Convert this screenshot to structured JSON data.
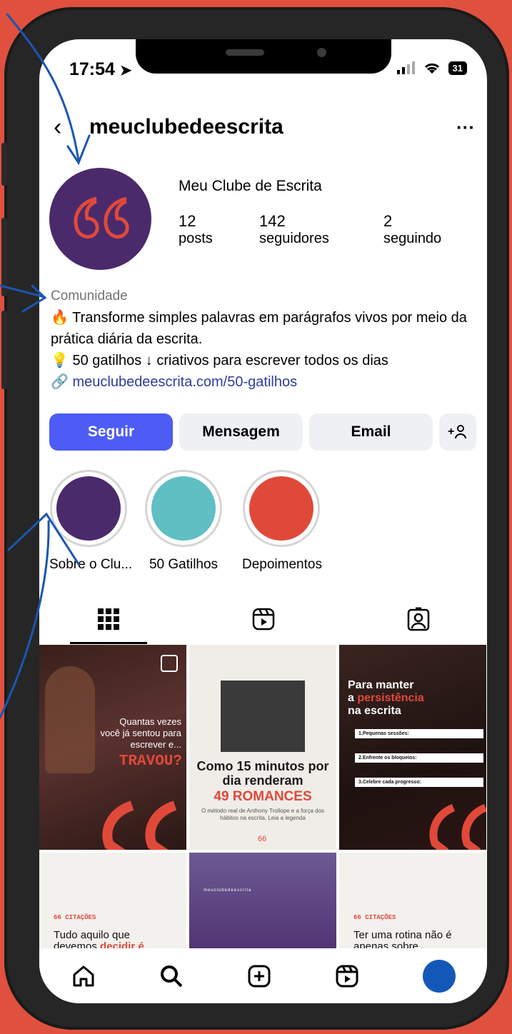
{
  "status_bar": {
    "time": "17:54",
    "battery": "31"
  },
  "header": {
    "username": "meuclubedeescrita"
  },
  "profile": {
    "name": "Meu Clube de Escrita",
    "stats": [
      {
        "value": "12",
        "label": "posts"
      },
      {
        "value": "142",
        "label": "seguidores"
      },
      {
        "value": "2",
        "label": "seguindo"
      }
    ],
    "category": "Comunidade",
    "bio_line1": "Transforme simples palavras em parágrafos vivos por meio da prática diária da escrita.",
    "bio_line2": "50 gatilhos ↓ criativos para escrever todos os dias",
    "link": "meuclubedeescrita.com/50-gatilhos"
  },
  "buttons": {
    "follow": "Seguir",
    "message": "Mensagem",
    "email": "Email",
    "add_person": "+"
  },
  "highlights": [
    {
      "label": "Sobre o Clu...",
      "color": "#4a2a6b"
    },
    {
      "label": "50 Gatilhos",
      "color": "#5fbfc3"
    },
    {
      "label": "Depoimentos",
      "color": "#e0493a"
    }
  ],
  "posts": [
    {
      "text1": "Quantas vezes você já sentou para escrever e...",
      "text2": "TRAVOU?"
    },
    {
      "text1": "Como 15 minutos por dia renderam",
      "text2": "49 ROMANCES",
      "text3": "O método real de Anthony Trollope e a força dos hábitos na escrita. Leia a legenda"
    },
    {
      "title1": "Para manter",
      "title2": "a",
      "title3": "persistência",
      "title4": "na escrita",
      "items": [
        "1.Pequenas sessões:",
        "2.Enfrente os bloqueios:",
        "3.Celebre cada progresso:"
      ]
    },
    {
      "tag": "CITAÇÕES",
      "text1": "Tudo aquilo que devemos",
      "text2": "decidir é"
    },
    {
      "tag": "meuclubedeescrita"
    },
    {
      "tag": "CITAÇÕES",
      "text1": "Ter uma rotina não é apenas sobre"
    }
  ],
  "colors": {
    "accent": "#4d5cf5",
    "brand_purple": "#4a2a6b",
    "brand_red": "#e0493a",
    "annotation_blue": "#1a56b0"
  }
}
